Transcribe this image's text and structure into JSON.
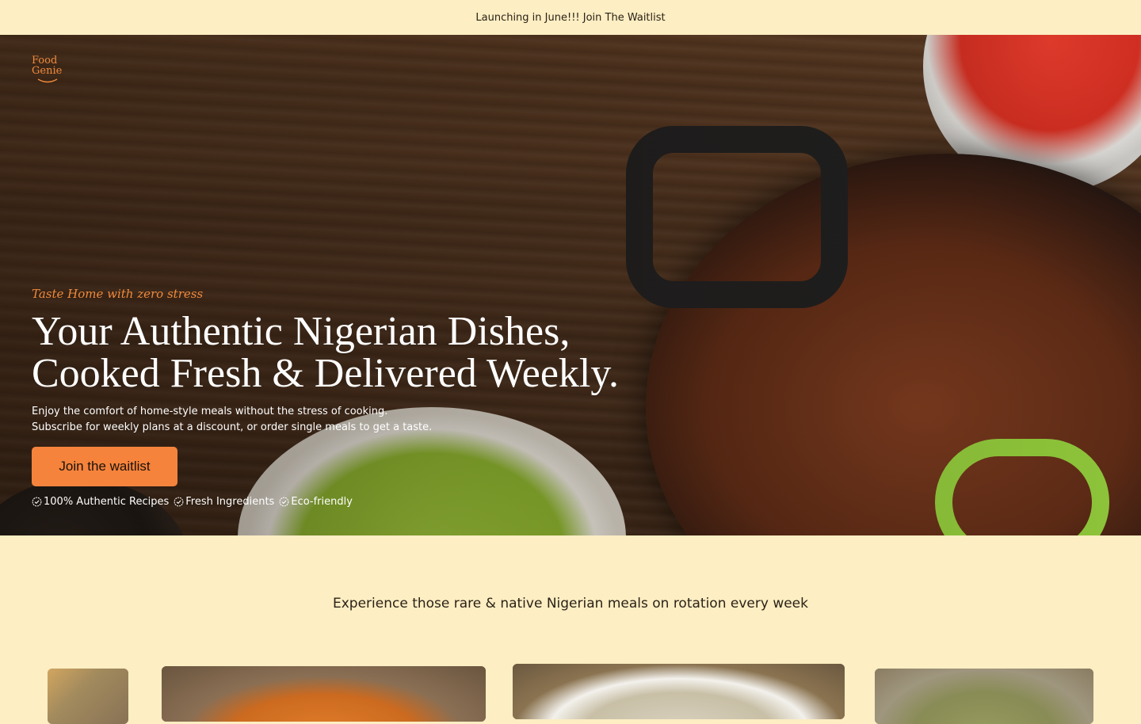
{
  "announcement": {
    "text": "Launching in June!!! Join The Waitlist"
  },
  "brand": {
    "logo_line1": "Food",
    "logo_line2": "Genie"
  },
  "hero": {
    "tagline": "Taste Home with zero stress",
    "headline_line1": "Your Authentic Nigerian Dishes,",
    "headline_line2": "Cooked Fresh & Delivered Weekly.",
    "sub_line1": "Enjoy the comfort of home-style meals without the stress of cooking.",
    "sub_line2": "Subscribe for weekly plans at a discount, or order single meals to get a taste.",
    "cta_label": "Join the waitlist",
    "features": [
      {
        "label": "100% Authentic Recipes",
        "icon": "check-badge-icon"
      },
      {
        "label": "Fresh Ingredients",
        "icon": "check-badge-icon"
      },
      {
        "label": "Eco-friendly",
        "icon": "check-badge-icon"
      }
    ]
  },
  "section": {
    "intro": "Experience those rare & native Nigerian meals on rotation every week"
  },
  "colors": {
    "accent": "#f6833c",
    "background": "#fdeec3",
    "headline": "#ffffff"
  }
}
